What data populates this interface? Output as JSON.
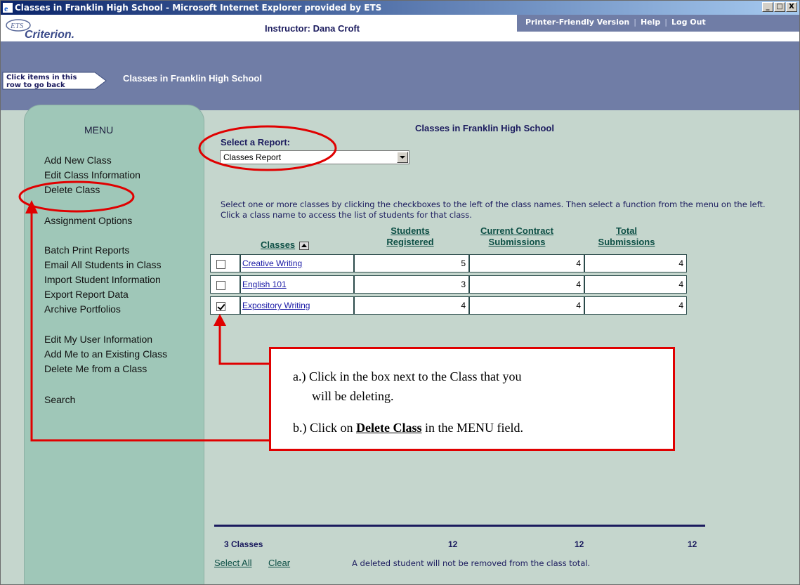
{
  "window": {
    "title": "Classes in Franklin High School - Microsoft Internet Explorer provided by ETS",
    "buttons": [
      "_",
      "□",
      "X"
    ]
  },
  "header": {
    "logo_ets": "ETS",
    "logo_name": "Criterion.",
    "instructor": "Instructor: Dana Croft",
    "links": [
      "Printer-Friendly Version",
      "Help",
      "Log Out"
    ]
  },
  "breadcrumb": {
    "button_label_line1": "Click items in this",
    "button_label_line2": "row to go back",
    "title": "Classes in Franklin High School"
  },
  "menu": {
    "title": "MENU",
    "items": [
      "Add New Class",
      "Edit Class Information",
      "Delete Class",
      "Assignment Options",
      "Batch Print Reports",
      "Email All Students in Class",
      "Import Student Information",
      "Export Report Data",
      "Archive Portfolios",
      "Edit My User Information",
      "Add Me to an Existing Class",
      "Delete Me from a Class",
      "Search"
    ]
  },
  "main": {
    "page_title": "Classes in Franklin High School",
    "select_label": "Select a Report:",
    "select_value": "Classes Report",
    "instructions": "Select one or more classes by clicking the checkboxes to the left of the class names. Then select a function from the menu on the left. Click a class name to access the list of students for that class.",
    "columns": {
      "classes": "Classes",
      "students_line1": "Students",
      "students_line2": "Registered",
      "contract_line1": "Current Contract",
      "contract_line2": "Submissions",
      "total_line1": "Total",
      "total_line2": "Submissions"
    },
    "rows": [
      {
        "name": "Creative Writing",
        "students": "5",
        "contract": "4",
        "total": "4",
        "checked": false
      },
      {
        "name": "English 101",
        "students": "3",
        "contract": "4",
        "total": "4",
        "checked": false
      },
      {
        "name": "Expository Writing",
        "students": "4",
        "contract": "4",
        "total": "4",
        "checked": true
      }
    ],
    "totals": {
      "classes": "3 Classes",
      "students": "12",
      "contract": "12",
      "total": "12"
    },
    "select_all": "Select All",
    "clear": "Clear",
    "footnote": "A deleted student will not be removed from the class total."
  },
  "callout": {
    "a_prefix": "a.)  Click in the box next to the Class that you",
    "a_line2": "will be deleting.",
    "b_prefix": "b.)  Click on ",
    "b_bold": "Delete Class",
    "b_suffix": " in the MENU field."
  },
  "colors": {
    "accent_red": "#e00000",
    "header_blue": "#707da6",
    "menu_green": "#9fc7b8",
    "page_bg": "#c5d6cd"
  }
}
